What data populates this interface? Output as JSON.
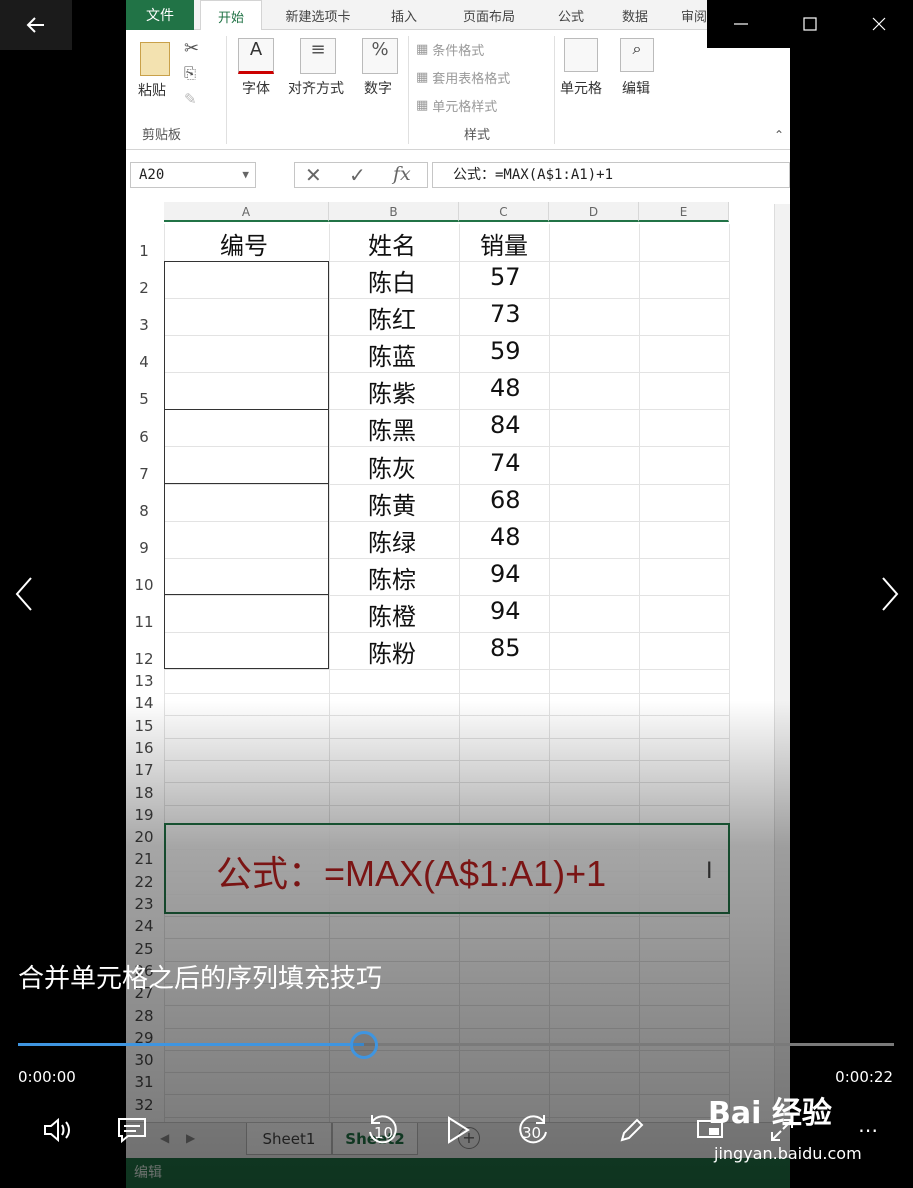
{
  "excel": {
    "ribbon_tabs": [
      "文件",
      "开始",
      "新建选项卡",
      "插入",
      "页面布局",
      "公式",
      "数据",
      "审阅"
    ],
    "ribbon_buttons": {
      "paste": "粘贴",
      "font": "字体",
      "align": "对齐方式",
      "number": "数字",
      "cond_format": "条件格式",
      "table_format": "套用表格格式",
      "cell_style": "单元格样式",
      "cells": "单元格",
      "edit": "编辑",
      "clipboard_group": "剪贴板",
      "styles_group": "样式"
    },
    "name_box": "A20",
    "formula": "公式：=MAX(A$1:A1)+1",
    "columns": [
      "A",
      "B",
      "C",
      "D",
      "E"
    ],
    "headers": {
      "a": "编号",
      "b": "姓名",
      "c": "销量"
    },
    "rows": [
      {
        "name": "陈白",
        "sales": "57"
      },
      {
        "name": "陈红",
        "sales": "73"
      },
      {
        "name": "陈蓝",
        "sales": "59"
      },
      {
        "name": "陈紫",
        "sales": "48"
      },
      {
        "name": "陈黑",
        "sales": "84"
      },
      {
        "name": "陈灰",
        "sales": "74"
      },
      {
        "name": "陈黄",
        "sales": "68"
      },
      {
        "name": "陈绿",
        "sales": "48"
      },
      {
        "name": "陈棕",
        "sales": "94"
      },
      {
        "name": "陈橙",
        "sales": "94"
      },
      {
        "name": "陈粉",
        "sales": "85"
      }
    ],
    "row_numbers": [
      "1",
      "2",
      "3",
      "4",
      "5",
      "6",
      "7",
      "8",
      "9",
      "10",
      "11",
      "12",
      "13",
      "14",
      "15",
      "16",
      "17",
      "18",
      "19",
      "20",
      "21",
      "22",
      "23",
      "24",
      "25",
      "26",
      "27",
      "28",
      "29",
      "30",
      "31",
      "32"
    ],
    "callout": "公式：=MAX(A$1:A1)+1",
    "sheet_tabs": [
      "Sheet1",
      "Sheet2"
    ],
    "status": "编辑"
  },
  "player": {
    "title": "合并单元格之后的序列填充技巧",
    "time_current": "0:00:00",
    "time_total": "0:00:22",
    "progress": 0.395,
    "skip_back": "10",
    "skip_forward": "30"
  },
  "watermark": {
    "brand": "Bai 经验",
    "url": "jingyan.baidu.com"
  },
  "colors": {
    "excel_green": "#217346",
    "accent_blue": "#3f95e0",
    "formula_red": "#c0201f"
  }
}
